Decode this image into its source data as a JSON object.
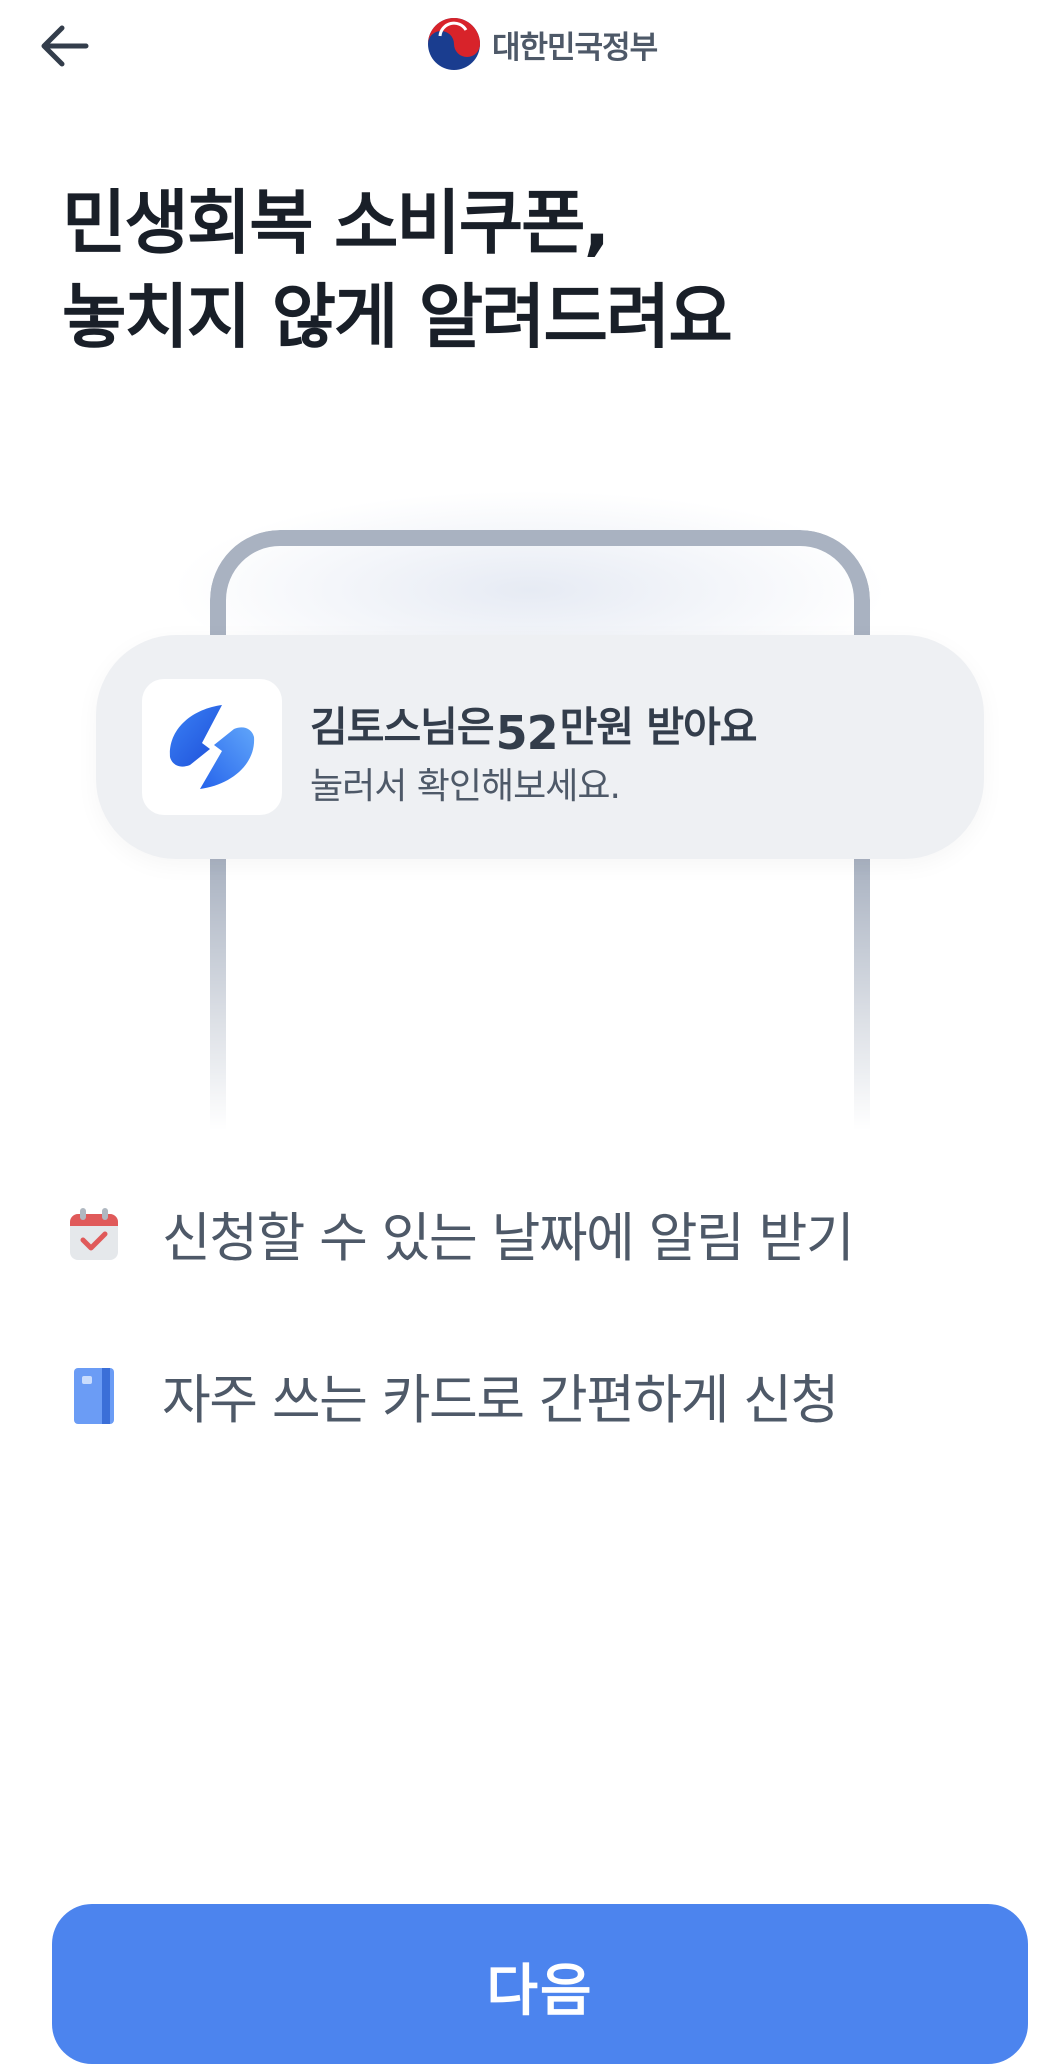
{
  "header": {
    "back_icon": "arrow-left-icon",
    "logo_icon": "taegeuk-emblem-icon",
    "logo_text": "대한민국정부"
  },
  "headline": {
    "line1": "민생회복 소비쿠폰,",
    "line2": "놓치지 않게 알려드려요"
  },
  "notification": {
    "app_icon": "toss-logo-icon",
    "title_before": "김토스님은",
    "amount": "52",
    "title_after": "만원 받아요",
    "subtitle": "눌러서 확인해보세요."
  },
  "features": [
    {
      "icon": "calendar-check-icon",
      "text": "신청할 수 있는 날짜에 알림 받기"
    },
    {
      "icon": "card-icon",
      "text": "자주 쓰는 카드로 간편하게 신청"
    }
  ],
  "footer": {
    "next_label": "다음"
  },
  "colors": {
    "primary": "#4c84ee",
    "text_dark": "#191f28",
    "text_gray": "#4e5968",
    "notification_bg": "#eef0f3",
    "phone_frame": "#a9b2c1"
  }
}
